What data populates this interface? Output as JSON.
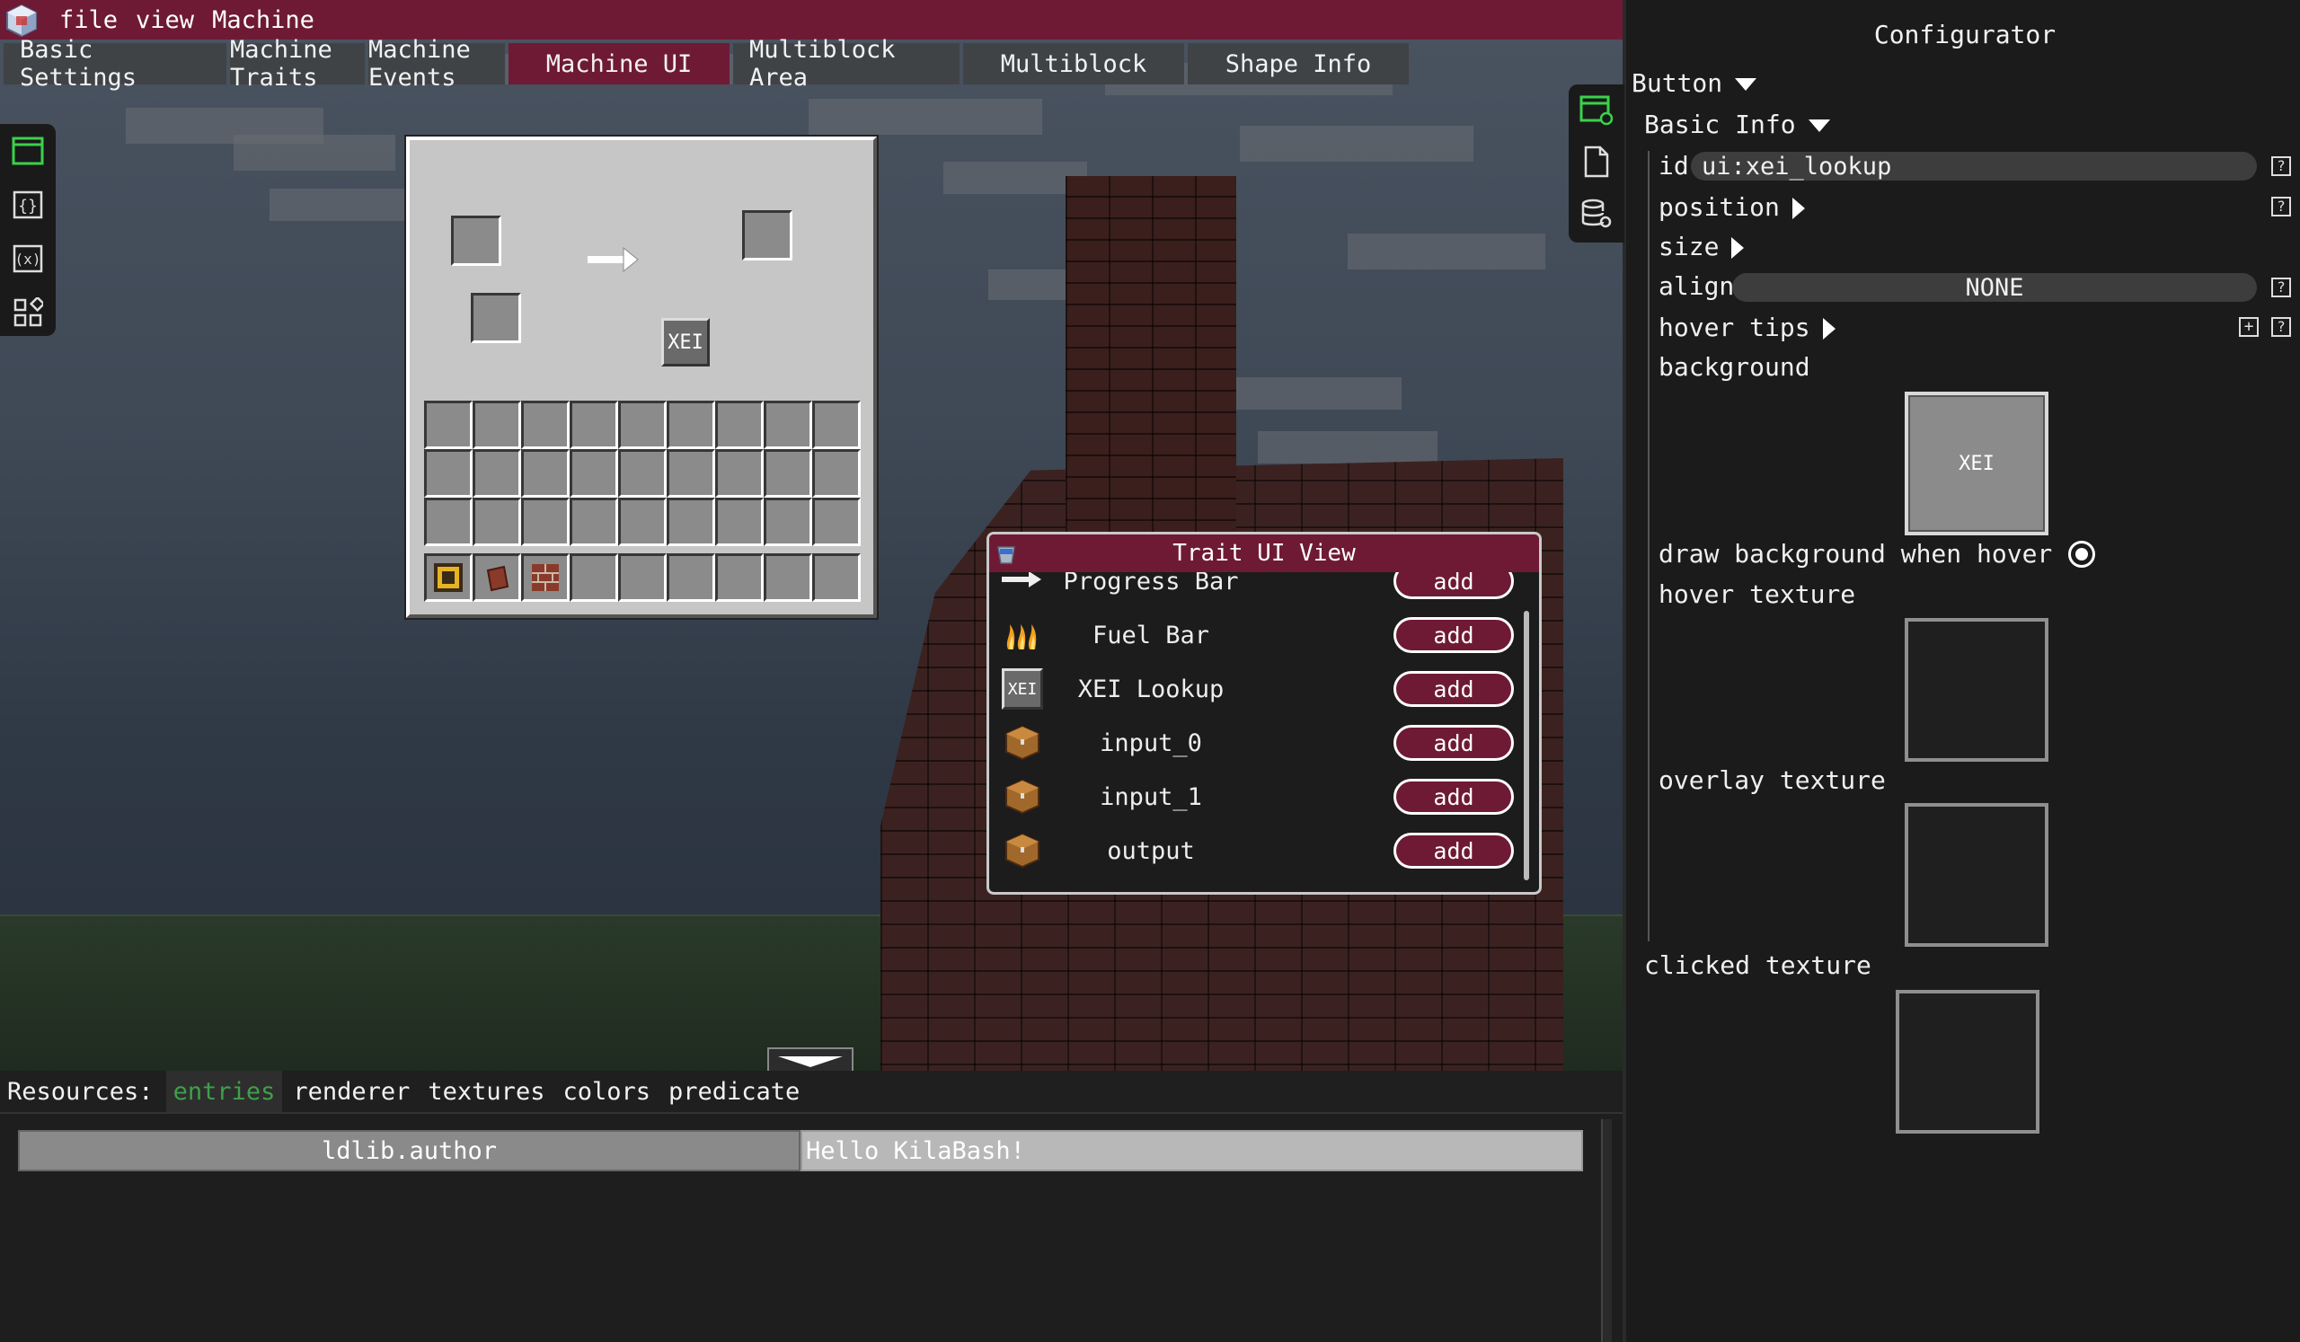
{
  "menubar": {
    "items": [
      "file",
      "view",
      "Machine"
    ]
  },
  "tabs": [
    {
      "label": "Basic Settings"
    },
    {
      "label": "Machine Traits"
    },
    {
      "label": "Machine Events"
    },
    {
      "label": "Machine UI"
    },
    {
      "label": "Multiblock Area"
    },
    {
      "label": "Multiblock"
    },
    {
      "label": "Shape Info"
    }
  ],
  "active_tab": "Machine UI",
  "machine_gui": {
    "xei_button_label": "XEI"
  },
  "trait_view": {
    "title": "Trait UI View",
    "rows": [
      {
        "name": "Progress Bar",
        "button": "add",
        "icon": "progress-arrow-icon"
      },
      {
        "name": "Fuel Bar",
        "button": "add",
        "icon": "flame-icon"
      },
      {
        "name": "XEI Lookup",
        "button": "add",
        "icon": "xei-icon",
        "icon_text": "XEI"
      },
      {
        "name": "input_0",
        "button": "add",
        "icon": "chest-icon"
      },
      {
        "name": "input_1",
        "button": "add",
        "icon": "chest-icon"
      },
      {
        "name": "output",
        "button": "add",
        "icon": "chest-icon"
      }
    ]
  },
  "resources": {
    "label": "Resources:",
    "tabs": [
      "entries",
      "renderer",
      "textures",
      "colors",
      "predicate"
    ],
    "active_tab": "entries",
    "entries": [
      {
        "key": "ldlib.author",
        "value": "Hello KilaBash!"
      }
    ]
  },
  "configurator": {
    "title": "Configurator",
    "widget_type": "Button",
    "section": "Basic Info",
    "id_label": "id",
    "id_value": "ui:xei_lookup",
    "position_label": "position",
    "size_label": "size",
    "align_label": "align",
    "align_value": "NONE",
    "hover_tips_label": "hover tips",
    "background_label": "background",
    "background_preview": "XEI",
    "draw_bg_label": "draw background when hover",
    "draw_bg_value": true,
    "hover_texture_label": "hover texture",
    "overlay_texture_label": "overlay texture",
    "clicked_texture_label": "clicked texture"
  },
  "colors": {
    "accent": "#6f1a35",
    "active_green": "#3fa04a",
    "panel_bg": "#1b1b1b"
  }
}
